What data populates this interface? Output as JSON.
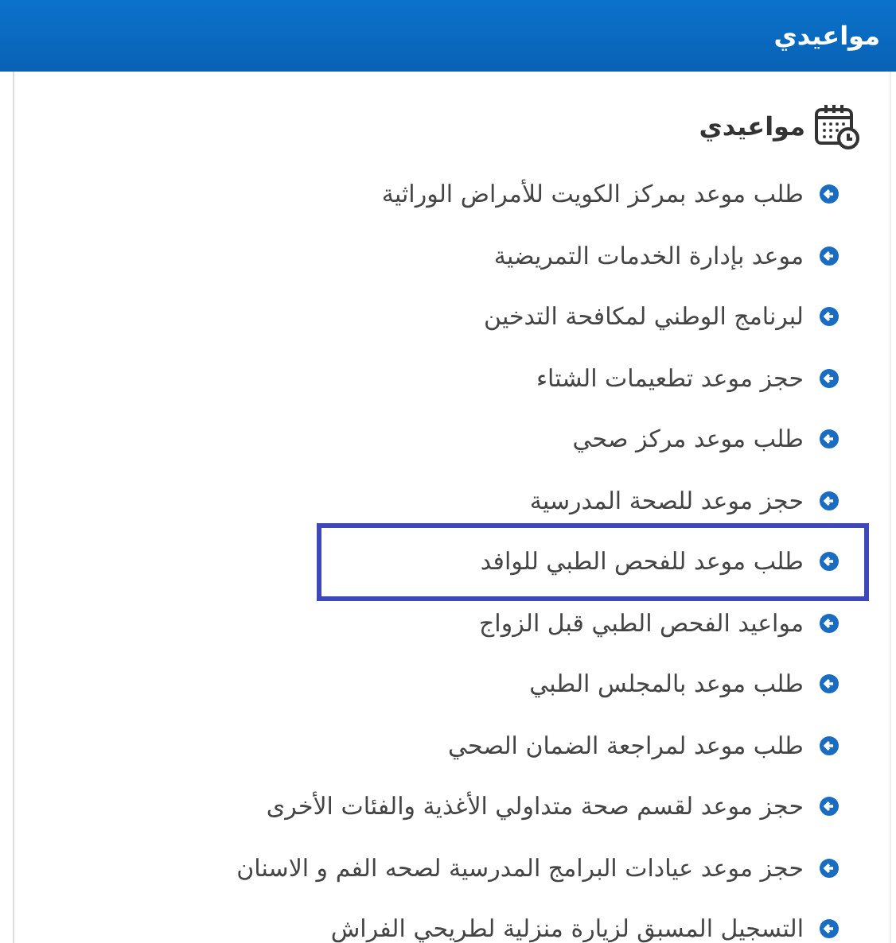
{
  "header": {
    "title": "مواعيدي"
  },
  "section": {
    "title": "مواعيدي"
  },
  "links": [
    {
      "label": "طلب موعد بمركز الكويت للأمراض الوراثية",
      "selected": false
    },
    {
      "label": "موعد بإدارة الخدمات التمريضية",
      "selected": false
    },
    {
      "label": "لبرنامج الوطني لمكافحة التدخين",
      "selected": false
    },
    {
      "label": "حجز موعد تطعيمات الشتاء",
      "selected": false
    },
    {
      "label": "طلب موعد مركز صحي",
      "selected": false
    },
    {
      "label": "حجز موعد للصحة المدرسية",
      "selected": false
    },
    {
      "label": "طلب موعد للفحص الطبي للوافد",
      "selected": true
    },
    {
      "label": "مواعيد الفحص الطبي قبل الزواج",
      "selected": false
    },
    {
      "label": "طلب موعد بالمجلس الطبي",
      "selected": false
    },
    {
      "label": "طلب موعد لمراجعة الضمان الصحي",
      "selected": false
    },
    {
      "label": "حجز موعد لقسم صحة متداولي الأغذية والفئات الأخرى",
      "selected": false
    },
    {
      "label": "حجز موعد عيادات البرامج المدرسية لصحه الفم و الاسنان",
      "selected": false
    },
    {
      "label": "التسجيل المسبق لزيارة منزلية لطريحي الفراش",
      "selected": false
    }
  ]
}
